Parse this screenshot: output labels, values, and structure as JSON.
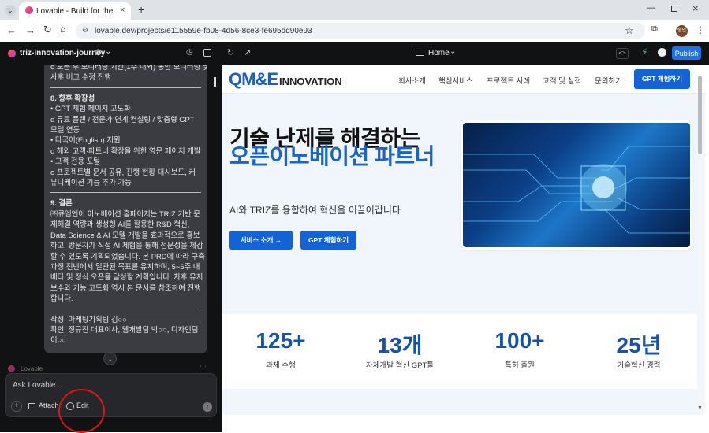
{
  "browser": {
    "tab_title": "Lovable - Build for the web 20",
    "url": "lovable.dev/projects/e115559e-fb08-4d56-8ce3-fe695dd90e93",
    "profile": "송인"
  },
  "app": {
    "project_name": "triz-innovation-journey",
    "page_selector": "Home",
    "publish_label": "Publish"
  },
  "chat": {
    "lines_top": [
      "o 오픈 후 모니터링 기간(1주 내외) 동안 모니터링 및",
      "사후 버그 수정 진행"
    ],
    "section8": [
      "8. 향후 확장성",
      "•  GPT 체험 페이지 고도화",
      "o  유료 플랜 / 전문가 연계 컨설팅 / 맞춤형 GPT",
      "모델 연동",
      "•  다국어(English) 지원",
      "o  해외 고객·파트너 확장을 위한 영문 페이지 개발",
      "•  고객 전용 포털",
      "o  프로젝트별 문서 공유, 진행 현황 대시보드, 커",
      "뮤니케이션 기능 추가 가능"
    ],
    "section9": [
      "9. 결론",
      "㈜큐엠엔이 이노베이션 홈페이지는 TRIZ 기반 문",
      "제해결 역량과 생성형 AI를 활용한 R&D 혁신,",
      "Data Science & AI 모델 개발을 효과적으로 홍보",
      "하고, 방문자가 직접 AI 체험을 통해 전문성을 체감",
      "할 수 있도록 기획되었습니다. 본 PRD에 따라 구축",
      "과정 전반에서 일관된 목표를 유지하며, 5~6주 내",
      "베타 및 정식 오픈을 달성할 계획입니다. 차후 유지",
      "보수와 기능 고도화 역시 본 문서를 참조하여 진행",
      "합니다."
    ],
    "author": [
      "작성: 마케팅기획팀 김○○",
      "확인: 정규진 대표이사, 웹개발팀 박○○, 디자인팀",
      "이○○"
    ],
    "sender": "Lovable",
    "input_placeholder": "Ask Lovable...",
    "attach_label": "Attach",
    "edit_label": "Edit"
  },
  "site": {
    "logo_main": "QM&E",
    "logo_sub": "INNOVATION",
    "nav": [
      "회사소개",
      "핵심서비스",
      "프로젝트 사례",
      "고객 및 실적",
      "문의하기"
    ],
    "nav_cta": "GPT 체험하기",
    "hero_title_1": "기술 난제를 해결하는",
    "hero_title_2": "오픈이노베이션 파트너",
    "hero_subtitle": "AI와 TRIZ를 융합하여 혁신을 이끌어갑니다",
    "btn_services": "서비스 소개  →",
    "btn_gpt": "GPT 체험하기",
    "stats": [
      {
        "value": "125+",
        "label": "과제 수행"
      },
      {
        "value": "13개",
        "label": "자체개발 혁신 GPT툴"
      },
      {
        "value": "100+",
        "label": "특허 출원"
      },
      {
        "value": "25년",
        "label": "기술혁신 경력"
      }
    ]
  },
  "colors": {
    "brand_blue": "#1463d6",
    "stat_blue": "#1553a8",
    "annotation_red": "#e0141a"
  }
}
